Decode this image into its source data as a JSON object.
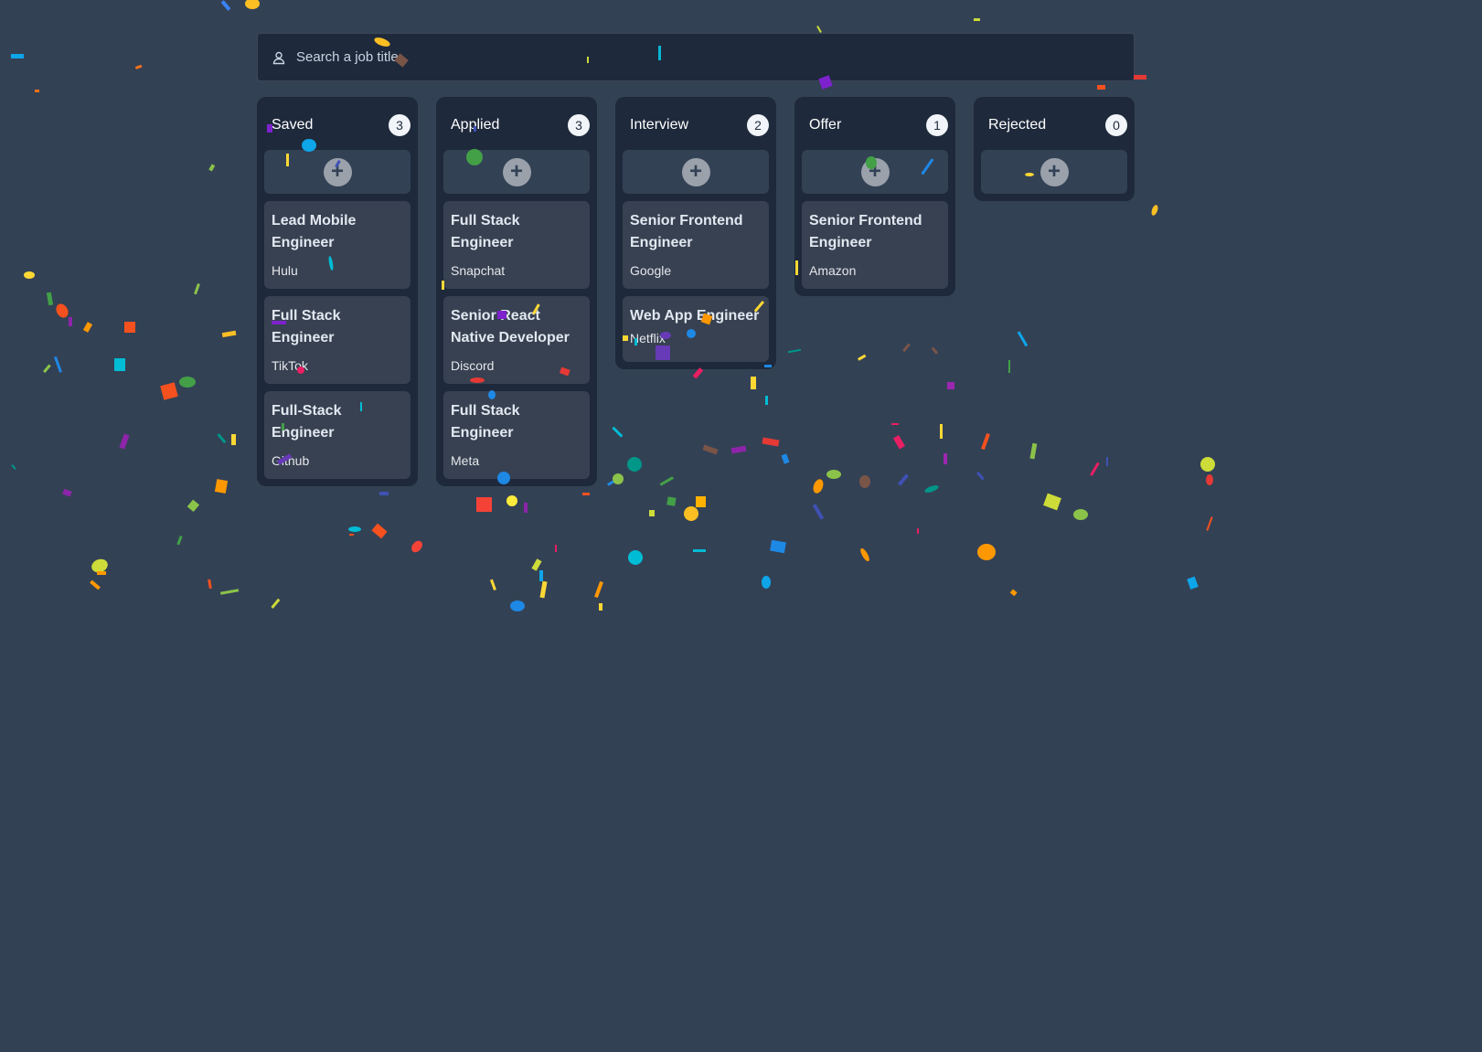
{
  "search": {
    "placeholder": "Search a job title"
  },
  "columns": [
    {
      "title": "Saved",
      "count": "3",
      "cards": [
        {
          "title": "Lead Mobile Engineer",
          "company": "Hulu"
        },
        {
          "title": "Full Stack Engineer",
          "company": "TikTok"
        },
        {
          "title": "Full-Stack Engineer",
          "company": "Github"
        }
      ]
    },
    {
      "title": "Applied",
      "count": "3",
      "cards": [
        {
          "title": "Full Stack Engineer",
          "company": "Snapchat"
        },
        {
          "title": "Senior React Native Developer",
          "company": "Discord"
        },
        {
          "title": "Full Stack Engineer",
          "company": "Meta"
        }
      ]
    },
    {
      "title": "Interview",
      "count": "2",
      "cards": [
        {
          "title": "Senior Frontend Engineer",
          "company": "Google"
        },
        {
          "title": "Web App Engineer",
          "company": "Netflix"
        }
      ]
    },
    {
      "title": "Offer",
      "count": "1",
      "cards": [
        {
          "title": "Senior Frontend Engineer",
          "company": "Amazon"
        }
      ]
    },
    {
      "title": "Rejected",
      "count": "0",
      "cards": []
    }
  ],
  "icons": {
    "search": "user-icon",
    "add": "plus-circle-icon"
  },
  "colors": {
    "background": "#334155",
    "column": "#1e293b",
    "card": "#374151",
    "badge": "#f1f5f9"
  }
}
